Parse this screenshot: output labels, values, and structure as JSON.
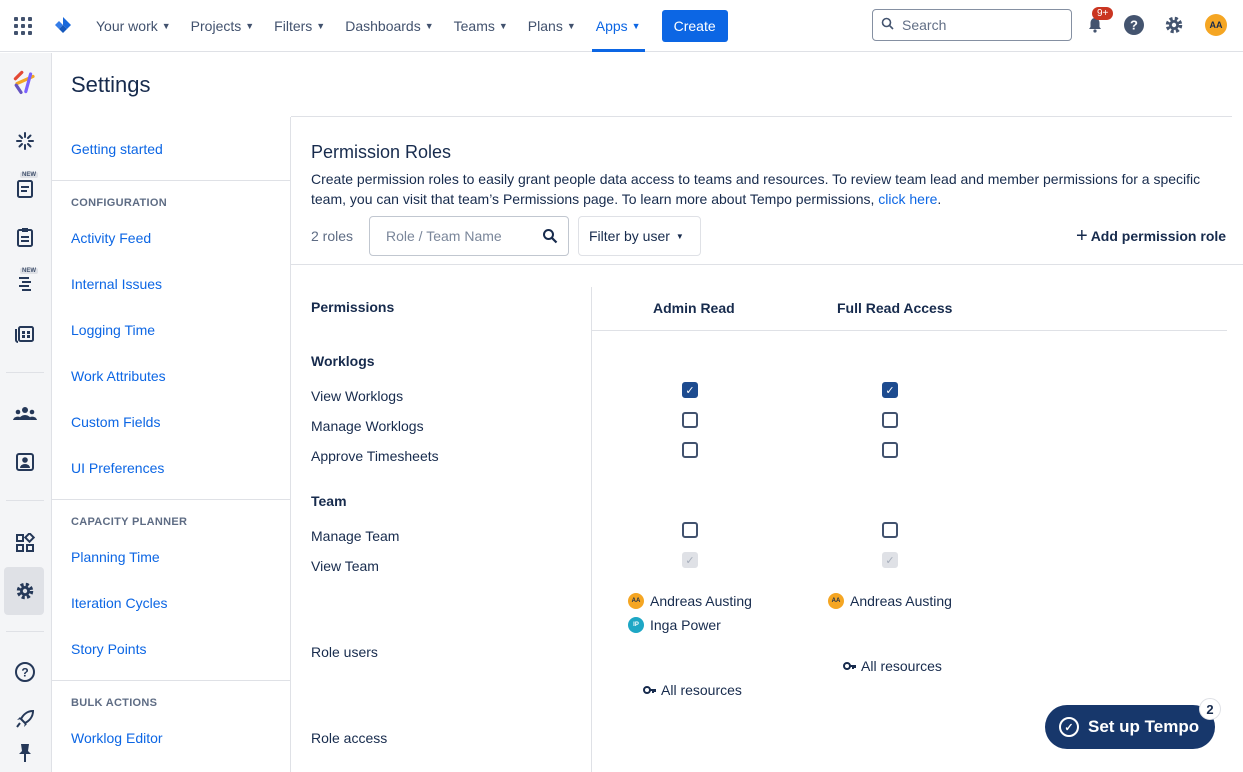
{
  "topnav": {
    "items": [
      {
        "label": "Your work"
      },
      {
        "label": "Projects"
      },
      {
        "label": "Filters"
      },
      {
        "label": "Dashboards"
      },
      {
        "label": "Teams"
      },
      {
        "label": "Plans"
      },
      {
        "label": "Apps"
      }
    ],
    "active_item": "Apps",
    "create_label": "Create",
    "search_placeholder": "Search",
    "notification_badge": "9+",
    "user_initials": "AA",
    "accent_color": "#0c66e4"
  },
  "rail": {
    "icons": [
      "tempo-logo-icon",
      "activity-icon",
      "new-timesheet-icon",
      "clipboard-icon",
      "new-planner-icon",
      "calendar-grid-icon",
      "team-icon",
      "contact-card-icon",
      "apps-icon",
      "gear-icon",
      "help-icon",
      "rocket-icon",
      "pin-icon"
    ],
    "new_tag": "NEW"
  },
  "settings": {
    "title": "Settings",
    "getting_started": "Getting started",
    "configuration_heading": "CONFIGURATION",
    "configuration_items": [
      "Activity Feed",
      "Internal Issues",
      "Logging Time",
      "Work Attributes",
      "Custom Fields",
      "UI Preferences"
    ],
    "capacity_heading": "CAPACITY PLANNER",
    "capacity_items": [
      "Planning Time",
      "Iteration Cycles",
      "Story Points"
    ],
    "bulk_heading": "BULK ACTIONS",
    "bulk_items": [
      "Worklog Editor"
    ]
  },
  "main": {
    "title": "Permission Roles",
    "description": "Create permission roles to easily grant people data access to teams and resources. To review team lead and member permissions for a specific team, you can visit that team’s Permissions page. To learn more about Tempo permissions,",
    "description_link": "click here",
    "role_count": "2 roles",
    "search_placeholder": "Role / Team Name",
    "filter_label": "Filter by user",
    "add_label": "Add permission role"
  },
  "table": {
    "permissions_header": "Permissions",
    "roles": [
      {
        "name": "Admin Read",
        "view_worklogs": true,
        "manage_worklogs": false,
        "approve_timesheets": false,
        "manage_team": false,
        "view_team": "disabled-checked",
        "users": [
          {
            "initials": "AA",
            "name": "Andreas Austing",
            "color": "#f5a623"
          },
          {
            "initials": "IP",
            "name": "Inga Power",
            "color": "#1ea7c5"
          }
        ],
        "access": "All resources"
      },
      {
        "name": "Full Read Access",
        "view_worklogs": true,
        "manage_worklogs": false,
        "approve_timesheets": false,
        "manage_team": false,
        "view_team": "disabled-checked",
        "users": [
          {
            "initials": "AA",
            "name": "Andreas Austing",
            "color": "#f5a623"
          }
        ],
        "access": "All resources"
      }
    ],
    "worklogs_group": "Worklogs",
    "worklog_perms": [
      "View Worklogs",
      "Manage Worklogs",
      "Approve Timesheets"
    ],
    "team_group": "Team",
    "team_perms": [
      "Manage Team",
      "View Team"
    ],
    "role_users_label": "Role users",
    "role_access_label": "Role access"
  },
  "tempo": {
    "setup_label": "Set up Tempo",
    "badge": "2"
  }
}
